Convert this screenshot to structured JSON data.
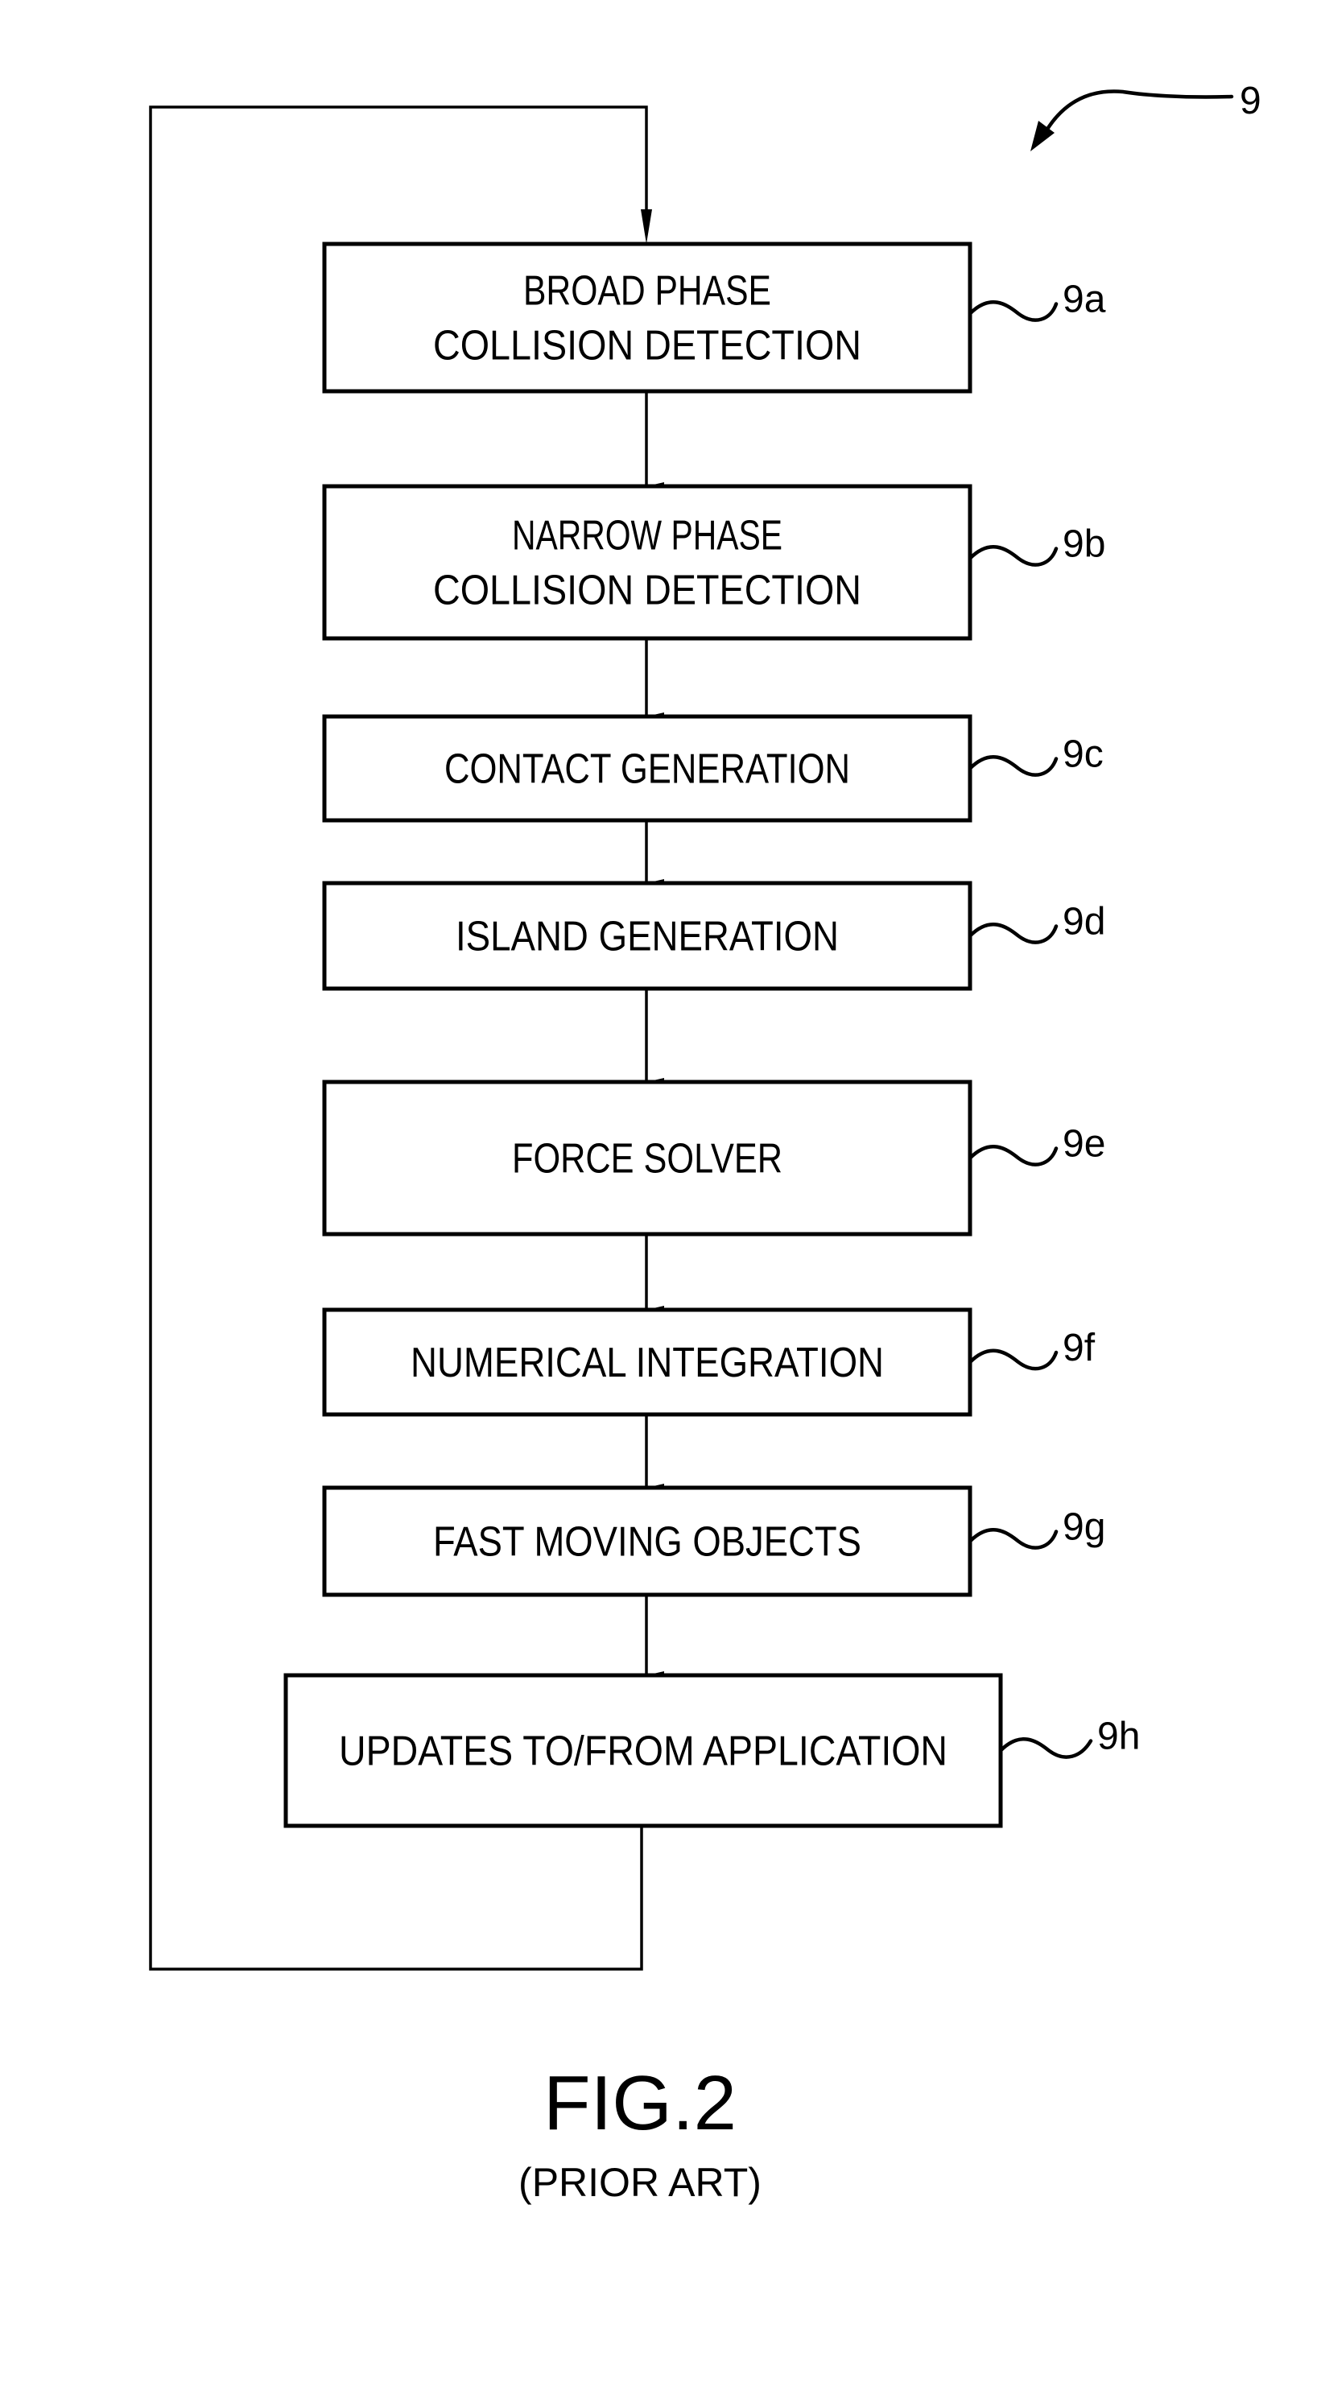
{
  "figure": {
    "reference": "9",
    "caption": "FIG.2",
    "subcaption": "(PRIOR ART)"
  },
  "steps": [
    {
      "ref": "9a",
      "lines": [
        "BROAD PHASE",
        "COLLISION DETECTION"
      ]
    },
    {
      "ref": "9b",
      "lines": [
        "NARROW PHASE",
        "COLLISION DETECTION"
      ]
    },
    {
      "ref": "9c",
      "lines": [
        "CONTACT GENERATION"
      ]
    },
    {
      "ref": "9d",
      "lines": [
        "ISLAND GENERATION"
      ]
    },
    {
      "ref": "9e",
      "lines": [
        "FORCE SOLVER"
      ]
    },
    {
      "ref": "9f",
      "lines": [
        "NUMERICAL INTEGRATION"
      ]
    },
    {
      "ref": "9g",
      "lines": [
        "FAST MOVING OBJECTS"
      ]
    },
    {
      "ref": "9h",
      "lines": [
        "UPDATES TO/FROM APPLICATION"
      ]
    }
  ],
  "colors": {
    "ink": "#000000",
    "paper": "#ffffff"
  }
}
